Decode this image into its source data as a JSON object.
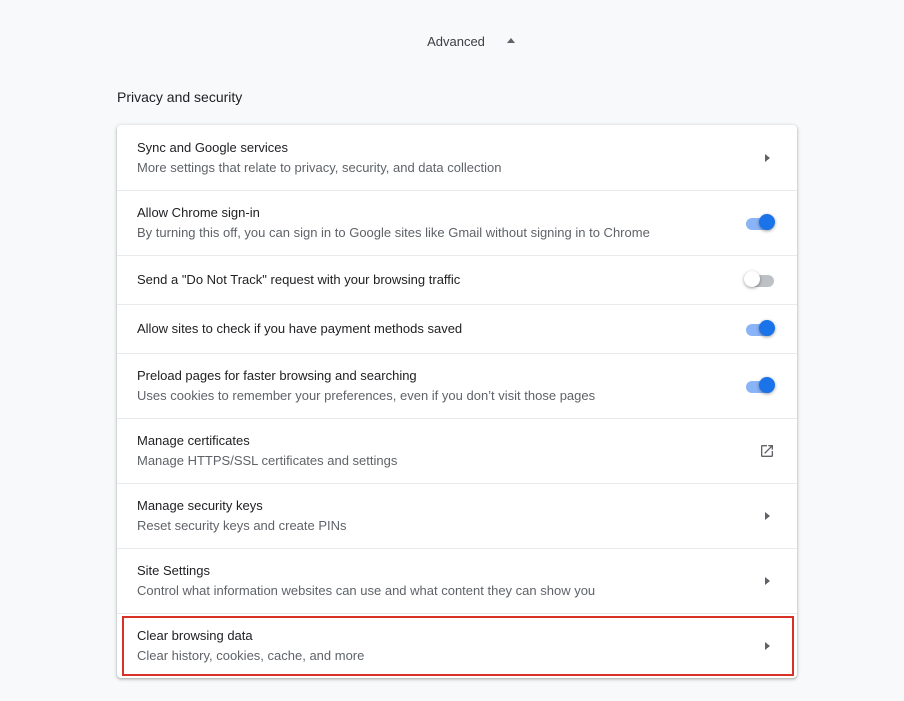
{
  "advanced": {
    "label": "Advanced"
  },
  "section": {
    "title": "Privacy and security"
  },
  "rows": [
    {
      "primary": "Sync and Google services",
      "secondary": "More settings that relate to privacy, security, and data collection",
      "control": "arrow"
    },
    {
      "primary": "Allow Chrome sign-in",
      "secondary": "By turning this off, you can sign in to Google sites like Gmail without signing in to Chrome",
      "control": "toggle",
      "enabled": true
    },
    {
      "primary": "Send a \"Do Not Track\" request with your browsing traffic",
      "control": "toggle",
      "enabled": false
    },
    {
      "primary": "Allow sites to check if you have payment methods saved",
      "control": "toggle",
      "enabled": true
    },
    {
      "primary": "Preload pages for faster browsing and searching",
      "secondary": "Uses cookies to remember your preferences, even if you don’t visit those pages",
      "control": "toggle",
      "enabled": true
    },
    {
      "primary": "Manage certificates",
      "secondary": "Manage HTTPS/SSL certificates and settings",
      "control": "external-link-icon"
    },
    {
      "primary": "Manage security keys",
      "secondary": "Reset security keys and create PINs",
      "control": "arrow"
    },
    {
      "primary": "Site Settings",
      "secondary": "Control what information websites can use and what content they can show you",
      "control": "arrow"
    },
    {
      "primary": "Clear browsing data",
      "secondary": "Clear history, cookies, cache, and more",
      "control": "arrow",
      "highlighted": true
    }
  ],
  "colors": {
    "accent": "#1a73e8",
    "highlight": "#d93025"
  }
}
